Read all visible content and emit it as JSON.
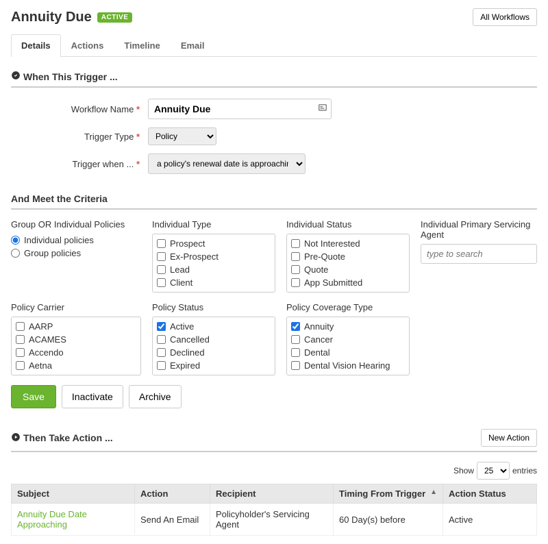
{
  "header": {
    "title": "Annuity Due",
    "status": "ACTIVE",
    "all_workflows": "All Workflows"
  },
  "tabs": {
    "details": "Details",
    "actions": "Actions",
    "timeline": "Timeline",
    "email": "Email"
  },
  "trigger": {
    "section_title": "When This Trigger ...",
    "name_label": "Workflow Name",
    "name_value": "Annuity Due",
    "type_label": "Trigger Type",
    "type_value": "Policy",
    "when_label": "Trigger when ...",
    "when_value": "a policy's renewal date is approaching"
  },
  "criteria": {
    "title": "And Meet the Criteria",
    "group_label": "Group OR Individual Policies",
    "radio_individual": "Individual policies",
    "radio_group": "Group policies",
    "ind_type_label": "Individual Type",
    "ind_type_opts": [
      "Prospect",
      "Ex-Prospect",
      "Lead",
      "Client"
    ],
    "ind_status_label": "Individual Status",
    "ind_status_opts": [
      "Not Interested",
      "Pre-Quote",
      "Quote",
      "App Submitted"
    ],
    "agent_label": "Individual Primary Servicing Agent",
    "agent_placeholder": "type to search",
    "carrier_label": "Policy Carrier",
    "carrier_opts": [
      "AARP",
      "ACAMES",
      "Accendo",
      "Aetna"
    ],
    "pstatus_label": "Policy Status",
    "pstatus_opts": [
      "Active",
      "Cancelled",
      "Declined",
      "Expired"
    ],
    "coverage_label": "Policy Coverage Type",
    "coverage_opts": [
      "Annuity",
      "Cancer",
      "Dental",
      "Dental Vision Hearing"
    ]
  },
  "buttons": {
    "save": "Save",
    "inactivate": "Inactivate",
    "archive": "Archive",
    "new_action": "New Action"
  },
  "then": {
    "title": "Then Take Action ...",
    "show": "Show",
    "entries": "entries",
    "page_size": "25"
  },
  "table": {
    "h_subject": "Subject",
    "h_action": "Action",
    "h_recipient": "Recipient",
    "h_timing": "Timing From Trigger",
    "h_status": "Action Status",
    "r0_subject": "Annuity Due Date Approaching",
    "r0_action": "Send An Email",
    "r0_recipient": "Policyholder's Servicing Agent",
    "r0_timing": "60 Day(s) before",
    "r0_status": "Active"
  }
}
